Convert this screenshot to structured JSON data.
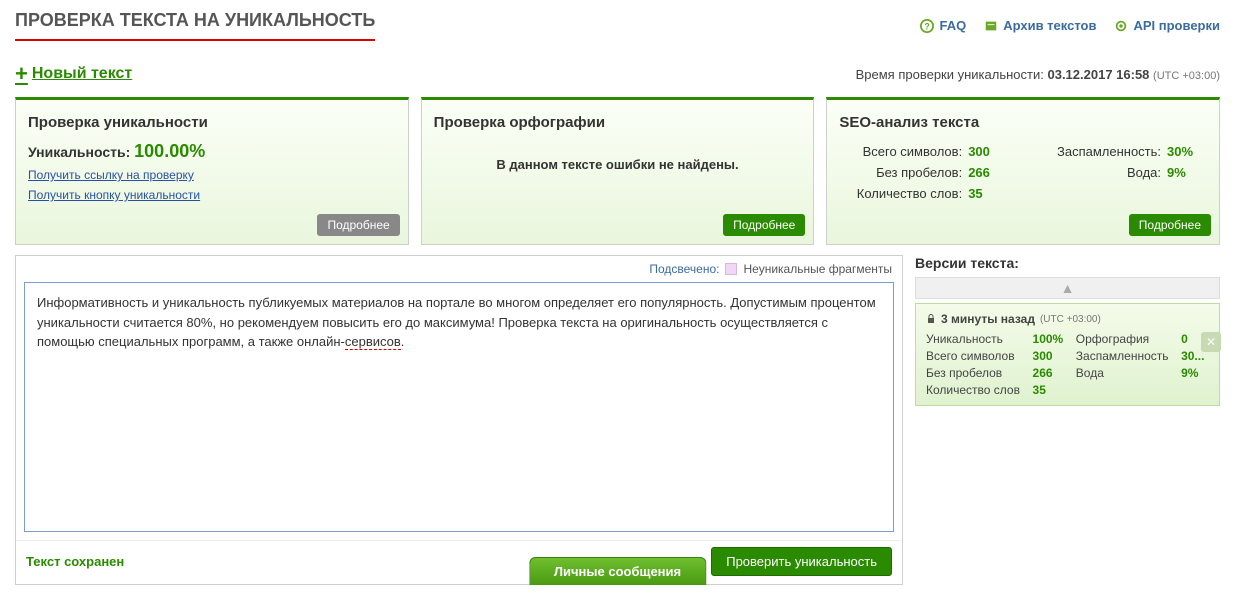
{
  "header": {
    "title": "ПРОВЕРКА ТЕКСТА НА УНИКАЛЬНОСТЬ",
    "faq": "FAQ",
    "archive": "Архив текстов",
    "api": "API проверки"
  },
  "row2": {
    "new_text": "Новый текст",
    "time_label": "Время проверки уникальности:",
    "time_value": "03.12.2017 16:58",
    "tz": "(UTC +03:00)"
  },
  "panel_uniq": {
    "title": "Проверка уникальности",
    "label": "Уникальность:",
    "pct": "100.00%",
    "link1": "Получить ссылку на проверку",
    "link2": "Получить кнопку уникальности",
    "more": "Подробнее"
  },
  "panel_spell": {
    "title": "Проверка орфографии",
    "message": "В данном тексте ошибки не найдены.",
    "more": "Подробнее"
  },
  "panel_seo": {
    "title": "SEO-анализ текста",
    "rows": {
      "total_chars_l": "Всего символов:",
      "total_chars_v": "300",
      "no_spaces_l": "Без пробелов:",
      "no_spaces_v": "266",
      "words_l": "Количество слов:",
      "words_v": "35",
      "spam_l": "Заспамленность:",
      "spam_v": "30%",
      "water_l": "Вода:",
      "water_v": "9%"
    },
    "more": "Подробнее"
  },
  "legend": {
    "highlighted": "Подсвечено:",
    "nonunique": "Неуникальные фрагменты"
  },
  "editor": {
    "text_a": "Информативность и уникальность публикуемых материалов на портале во многом определяет его популярность. Допустимым процентом уникальности считается 80%, но рекомендуем повысить его до максимума! Проверка текста на оригинальность осуществляется с помощью специальных программ, а также онлайн-",
    "text_b": "сервисов",
    "text_c": ".",
    "saved": "Текст сохранен",
    "check": "Проверить уникальность"
  },
  "versions": {
    "title": "Версии текста:",
    "head": "3 минуты назад",
    "tz": "(UTC +03:00)",
    "rows": {
      "uniq_l": "Уникальность",
      "uniq_v": "100%",
      "spell_l": "Орфография",
      "spell_v": "0",
      "chars_l": "Всего символов",
      "chars_v": "300",
      "spam_l": "Заспамленность",
      "spam_v": "30...",
      "nospace_l": "Без пробелов",
      "nospace_v": "266",
      "water_l": "Вода",
      "water_v": "9%",
      "words_l": "Количество слов",
      "words_v": "35"
    }
  },
  "pm": "Личные сообщения"
}
